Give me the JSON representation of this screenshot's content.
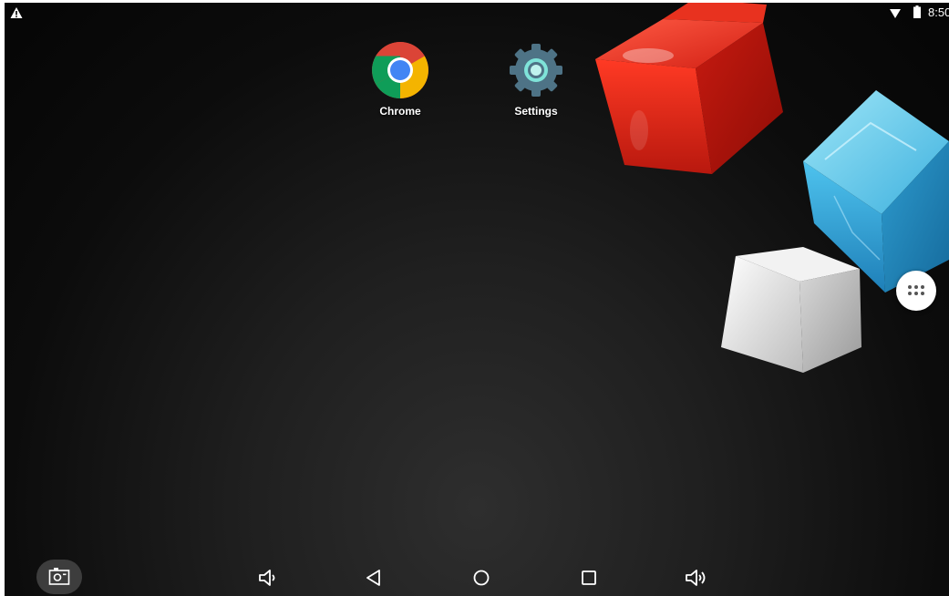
{
  "status_bar": {
    "time": "8:50",
    "icons": [
      "warning-icon",
      "wifi-icon",
      "battery-icon"
    ]
  },
  "home": {
    "apps": [
      {
        "label": "Chrome",
        "icon": "chrome-icon"
      },
      {
        "label": "Settings",
        "icon": "settings-gear-icon"
      }
    ],
    "all_apps_icon": "apps-grid-icon"
  },
  "nav_bar": {
    "buttons": [
      "screenshot-icon",
      "volume-down-icon",
      "back-icon",
      "home-icon",
      "recents-icon",
      "volume-up-icon"
    ]
  },
  "colors": {
    "cube_red": "#e0281c",
    "cube_blue": "#3fb6e0",
    "cube_white": "#e8e8e8",
    "settings_gear": "#4e7386",
    "settings_accent": "#7fe3d9"
  }
}
